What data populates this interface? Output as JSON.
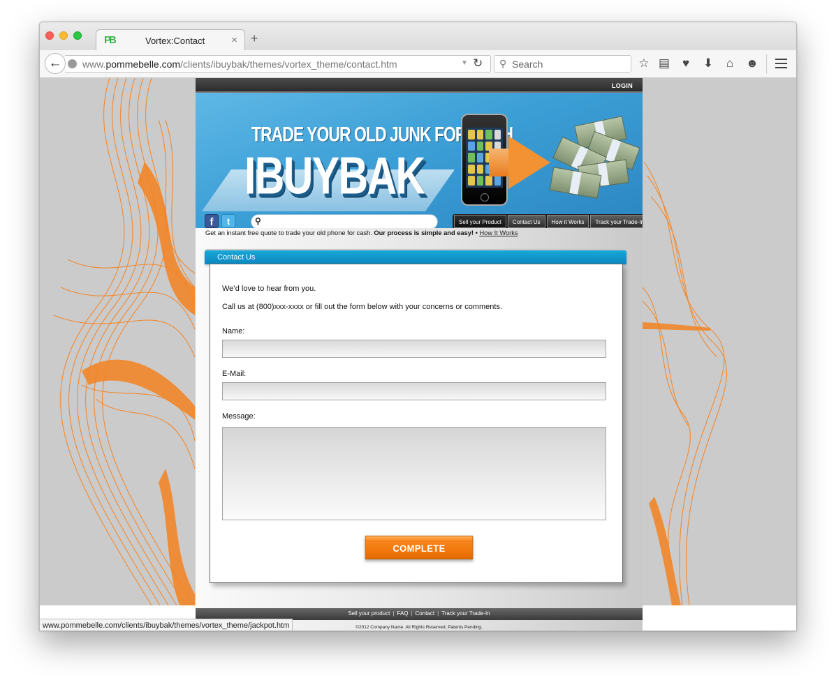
{
  "browser": {
    "tab_title": "Vortex:Contact",
    "tab_favicon": "PB",
    "url_plain_prefix": "www.",
    "url_domain": "pommebelle.com",
    "url_path": "/clients/ibuybak/themes/vortex_theme/contact.htm",
    "search_placeholder": "Search",
    "status_url": "www.pommebelle.com/clients/ibuybak/themes/vortex_theme/jackpot.htm",
    "toolbar_icons": [
      "star-icon",
      "reading-list-icon",
      "pocket-icon",
      "download-icon",
      "home-icon",
      "chat-icon",
      "menu-icon"
    ]
  },
  "site": {
    "login": "LOGIN",
    "banner": {
      "tagline": "TRADE YOUR OLD JUNK FOR CASH",
      "brand": "IBUYBAK"
    },
    "social": {
      "facebook": "f",
      "twitter": "t"
    },
    "menu": [
      "Sell your Product",
      "Contact Us",
      "How it Works",
      "Track your Trade-In"
    ],
    "intro": {
      "text": "Get an instant free quote to trade your old phone for cash.",
      "bold": "Our process is simple and easy!",
      "separator": "•",
      "link": "How It Works"
    },
    "contact": {
      "title": "Contact Us",
      "line1": "We’d love to hear from you.",
      "line2": "Call us at (800)xxx-xxxx or fill out the form below with your concerns or comments.",
      "name_label": "Name:",
      "email_label": "E-Mail:",
      "message_label": "Message:",
      "submit": "COMPLETE"
    },
    "footer": {
      "links": [
        "Sell your product",
        "FAQ",
        "Contact",
        "Track your Trade-In"
      ],
      "copyright": "©2012 Company Name. All Rights Reserved, Patents Pending."
    }
  },
  "colors": {
    "accent_orange": "#f37a0e",
    "banner_blue": "#3c9fd6",
    "panel_head_blue": "#0a87c0"
  }
}
